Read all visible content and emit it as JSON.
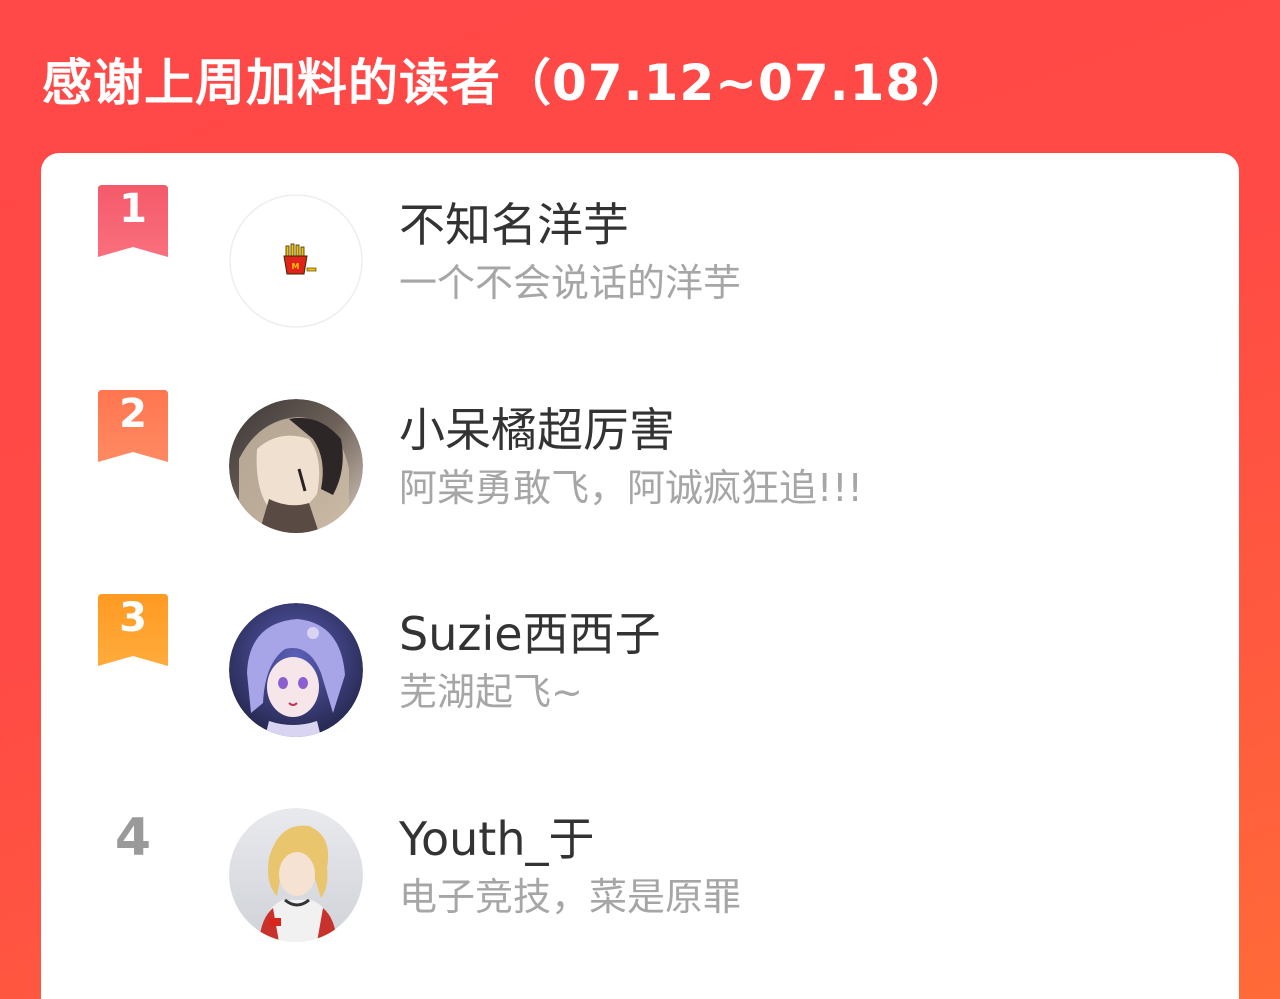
{
  "header": {
    "title": "感谢上周加料的读者（07.12~07.18）"
  },
  "colors": {
    "background_start": "#ff4848",
    "background_end": "#ff6a38",
    "rank1": "#f7556b",
    "rank2": "#ff7a52",
    "rank3": "#ff9e2c",
    "rank_plain": "#9a9a9a",
    "name": "#333333",
    "desc": "#a6a6a6"
  },
  "readers": [
    {
      "rank": "1",
      "name": "不知名洋芋",
      "desc": "一个不会说话的洋芋",
      "avatar_icon": "french-fries-icon"
    },
    {
      "rank": "2",
      "name": "小呆橘超厉害",
      "desc": "阿棠勇敢飞，阿诚疯狂追!!!",
      "avatar_icon": "anime-couple-avatar"
    },
    {
      "rank": "3",
      "name": "Suzie西西子",
      "desc": "芜湖起飞~",
      "avatar_icon": "anime-girl-avatar"
    },
    {
      "rank": "4",
      "name": "Youth_于",
      "desc": "电子竞技，菜是原罪",
      "avatar_icon": "anime-boy-avatar"
    }
  ]
}
